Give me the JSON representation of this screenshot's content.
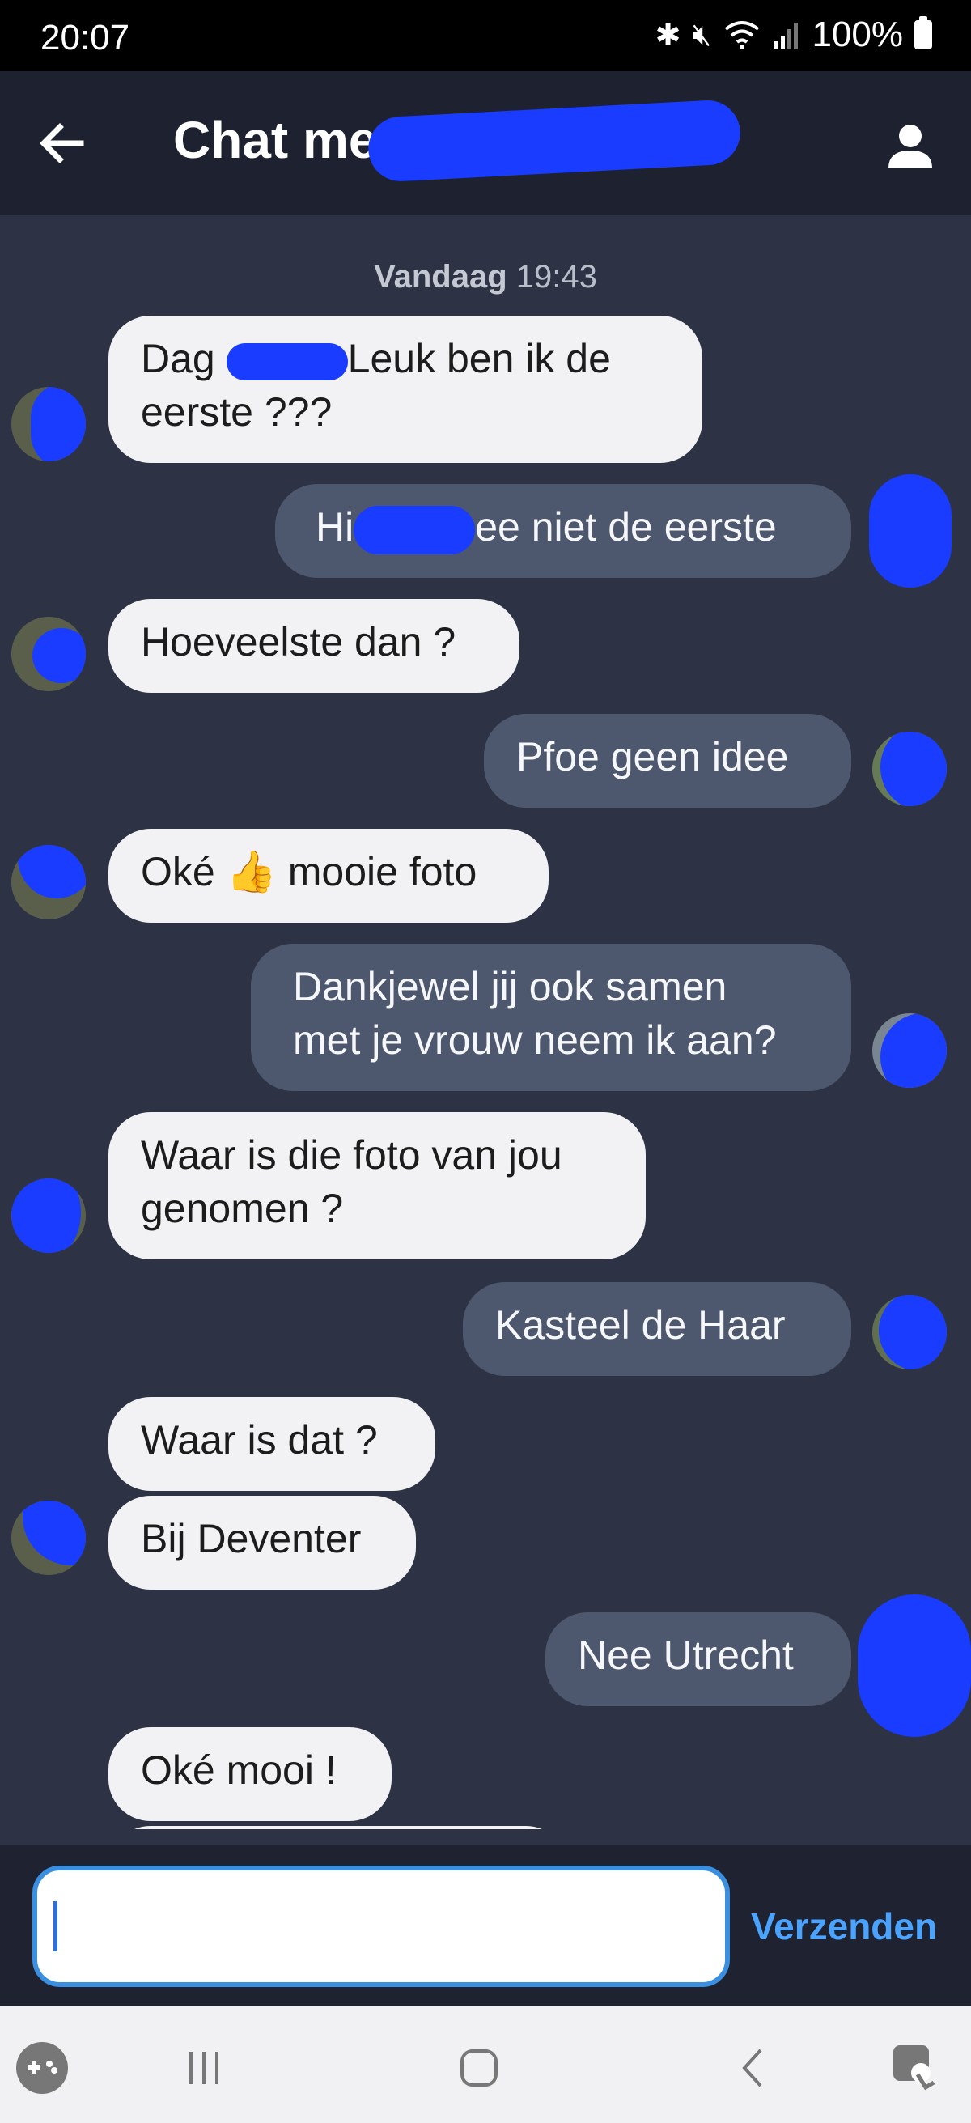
{
  "status_bar": {
    "time": "20:07",
    "battery": "100%",
    "icons": [
      "bluetooth-icon",
      "mute-icon",
      "wifi-icon",
      "signal-icon",
      "battery-icon"
    ]
  },
  "header": {
    "title": "Chat met",
    "back_icon": "arrow-left-icon",
    "profile_icon": "person-icon"
  },
  "date_separator": {
    "day": "Vandaag",
    "time": "19:43"
  },
  "messages": [
    {
      "side": "in",
      "text_1": "Dag",
      "text_2": "Leuk  ben ik de",
      "text_3": "eerste ???"
    },
    {
      "side": "out",
      "text_1": "Hi",
      "text_2": "ee niet de eerste"
    },
    {
      "side": "in",
      "text": "Hoeveelste dan ?"
    },
    {
      "side": "out",
      "text": "Pfoe geen idee"
    },
    {
      "side": "in",
      "text_1": "Oké",
      "emoji": "👍",
      "text_2": "mooie foto"
    },
    {
      "side": "out",
      "line_1": "Dankjewel jij ook samen",
      "line_2": "met je vrouw neem ik aan?"
    },
    {
      "side": "in",
      "line_1": "Waar is die foto van jou",
      "line_2": "genomen ?"
    },
    {
      "side": "out",
      "text": "Kasteel de Haar"
    },
    {
      "side": "in",
      "text": "Waar is dat ?"
    },
    {
      "side": "in",
      "text": "Bij Deventer"
    },
    {
      "side": "out",
      "text": "Nee Utrecht"
    },
    {
      "side": "in",
      "text": "Oké mooi !"
    }
  ],
  "composer": {
    "value": "",
    "placeholder": "",
    "send_label": "Verzenden"
  },
  "nav_bar": {
    "icons": [
      "game-launcher-icon",
      "recent-apps-icon",
      "home-icon",
      "back-icon",
      "accessibility-icon"
    ]
  },
  "colors": {
    "background": "#2d3344",
    "header": "#1e2230",
    "incoming_bubble": "#f2f2f4",
    "outgoing_bubble": "#4d586f",
    "accent": "#3b8fe0",
    "redaction": "#1a3cff"
  }
}
